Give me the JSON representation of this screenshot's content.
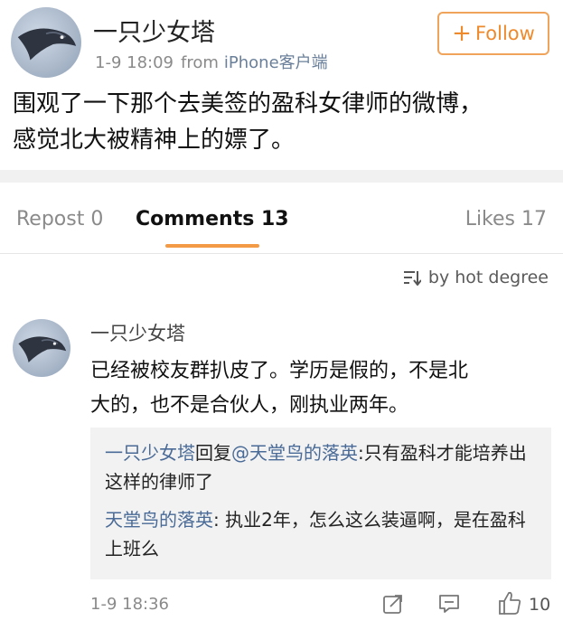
{
  "post": {
    "username": "一只少女塔",
    "time": "1-9 18:09",
    "from_label": "from",
    "client": "iPhone客户端",
    "follow_label": "Follow",
    "follow_icon": "plus-icon",
    "text_line1": "围观了一下那个去美签的盈科女律师的微博，",
    "text_line2": "感觉北大被精神上的嫖了。"
  },
  "tabs": {
    "repost": "Repost 0",
    "comments": "Comments 13",
    "likes": "Likes 17"
  },
  "sort": {
    "label": "by hot degree",
    "icon": "sort-icon"
  },
  "comment": {
    "username": "一只少女塔",
    "text_line1": "已经被校友群扒皮了。学历是假的，不是北",
    "text_line2": "大的，也不是合伙人，刚执业两年。",
    "replies": [
      {
        "user": "一只少女塔",
        "reply_word": "回复",
        "mention": "@天堂鸟的落英",
        "text": ":只有盈科才能培养出这样的律师了"
      },
      {
        "user": "天堂鸟的落英",
        "text": ": 执业2年，怎么这么装逼啊，是在盈科上班么"
      }
    ],
    "time": "1-9 18:36",
    "like_count": "10"
  },
  "colors": {
    "accent": "#ef8a2c",
    "link": "#4a6b97",
    "meta": "#8a8a8a"
  }
}
